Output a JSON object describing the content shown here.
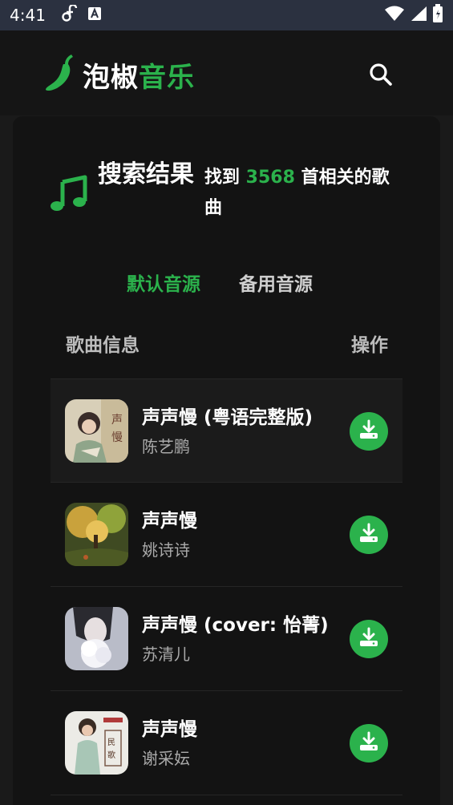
{
  "status_bar": {
    "time": "4:41",
    "icons": [
      "link-icon",
      "text-a-icon",
      "wifi-icon",
      "signal-icon",
      "battery-icon"
    ]
  },
  "header": {
    "logo_white": "泡椒",
    "logo_green": "音乐",
    "icons": [
      "chili-pepper-icon",
      "search-icon"
    ]
  },
  "result": {
    "title": "搜索结果",
    "count_prefix": "找到 ",
    "count": "3568",
    "count_suffix": " 首相关的歌曲"
  },
  "tabs": [
    {
      "label": "默认音源",
      "active": true
    },
    {
      "label": "备用音源",
      "active": false
    }
  ],
  "table_header": {
    "info": "歌曲信息",
    "action": "操作"
  },
  "songs": [
    {
      "title": "声声慢 (粤语完整版)",
      "artist": "陈艺鹏"
    },
    {
      "title": "声声慢",
      "artist": "姚诗诗"
    },
    {
      "title": "声声慢 (cover: 怡菁)",
      "artist": "苏清儿"
    },
    {
      "title": "声声慢",
      "artist": "谢采妘"
    }
  ],
  "colors": {
    "accent": "#2bb24c",
    "status_bar": "#2b3140",
    "header_bg": "#151515",
    "card_bg": "#131313"
  }
}
